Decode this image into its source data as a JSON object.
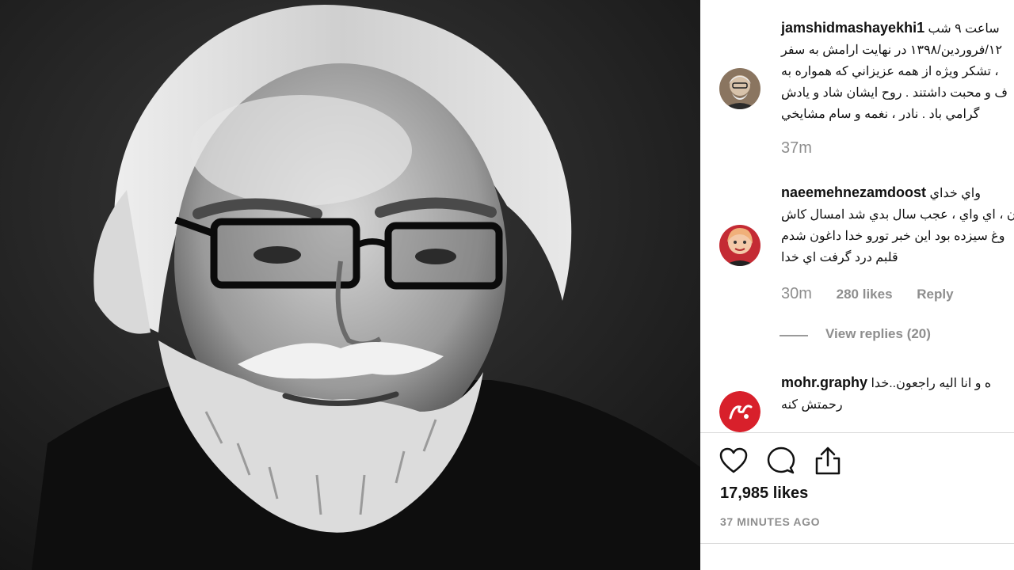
{
  "post": {
    "photo_alt": "Black and white portrait photograph",
    "likes_text": "17,985 likes",
    "time_ago": "37 MINUTES AGO"
  },
  "comments": [
    {
      "username": "jamshidmashayekhi1",
      "lines": [
        "ساعت ۹ شب",
        "۱۲/فروردين/۱۳۹۸ در نهايت ارامش به سفر",
        "، تشكر ويژه از همه عزيزاني كه همواره به",
        "ف و محبت داشتند . روح ايشان شاد و يادش",
        "گرامي باد . نادر ، نغمه و سام مشايخي"
      ],
      "time": "37m"
    },
    {
      "username": "naeemehnezamdoost",
      "lines": [
        "واي خداي",
        "ن ، اي واي ، عجب سال بدي شد امسال كاش",
        "وغ سيزده بود اين خبر تورو خدا داغون شدم",
        "قلبم درد گرفت اي خدا"
      ],
      "time": "30m",
      "likes": "280 likes",
      "reply": "Reply",
      "view_replies": "View replies (20)"
    },
    {
      "username": "mohr.graphy",
      "lines": [
        "ه و انا اليه راجعون..خدا",
        "رحمتش كنه"
      ]
    }
  ],
  "icons": [
    "heart-icon",
    "comment-icon",
    "share-icon"
  ],
  "colors": {
    "meta_gray": "#8e8e8e",
    "avatar_red": "#d8202b"
  }
}
